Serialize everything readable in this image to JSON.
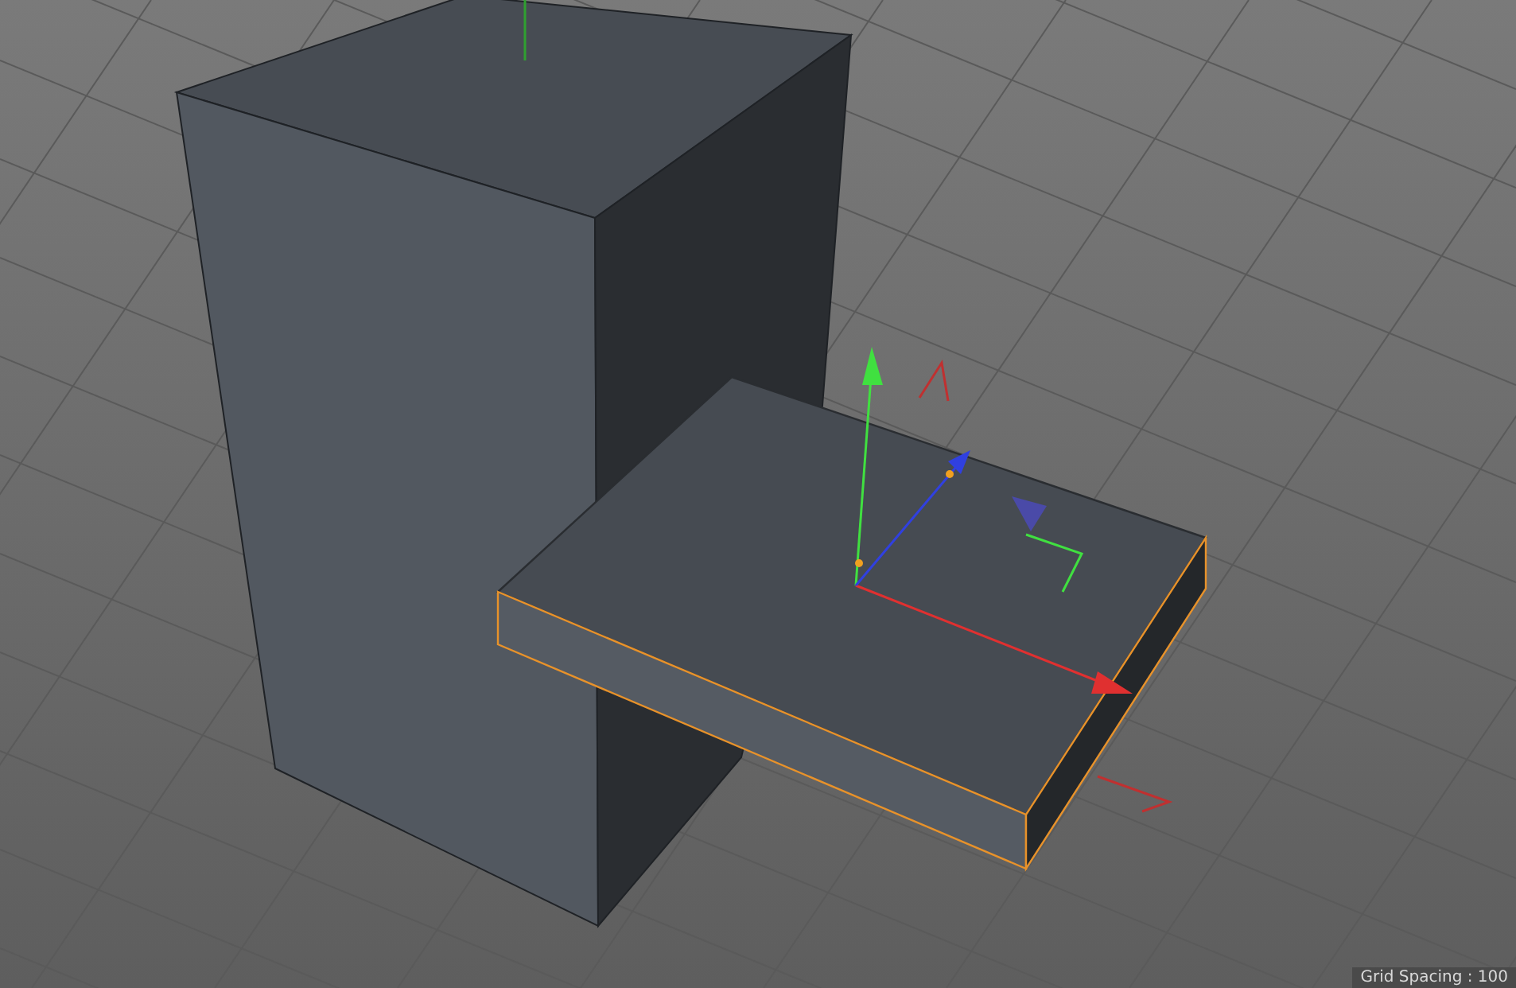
{
  "viewport": {
    "grid_label": "Grid Spacing : 100"
  }
}
